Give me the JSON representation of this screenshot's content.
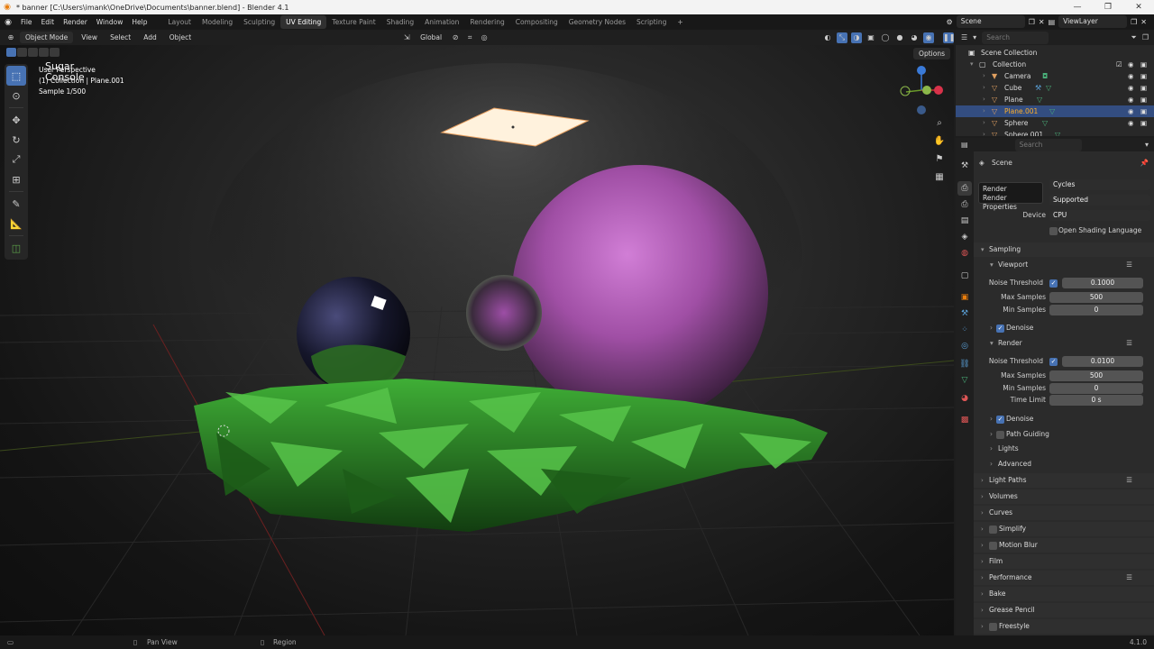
{
  "window": {
    "title": "* banner [C:\\Users\\imank\\OneDrive\\Documents\\banner.blend] - Blender 4.1",
    "buttons": [
      "—",
      "❐",
      "✕"
    ]
  },
  "menu": [
    "File",
    "Edit",
    "Render",
    "Window",
    "Help"
  ],
  "workspaces": [
    "Layout",
    "Modeling",
    "Sculpting",
    "UV Editing",
    "Texture Paint",
    "Shading",
    "Animation",
    "Rendering",
    "Compositing",
    "Geometry Nodes",
    "Scripting"
  ],
  "active_workspace": "UV Editing",
  "topbar_right": {
    "scene": "Scene",
    "view_layer": "ViewLayer"
  },
  "viewport_header": {
    "mode": "Object Mode",
    "menus": [
      "View",
      "Select",
      "Add",
      "Object"
    ],
    "orientation": "Global",
    "options": "Options"
  },
  "viewport_overlay": {
    "line1": "User Perspective",
    "line2": "(1) Collection | Plane.001",
    "line3": "Sample 1/500",
    "watermark_1": "Sugar",
    "watermark_2": "Console"
  },
  "statusbar": {
    "left": "Pan View",
    "middle": "Region",
    "version": "4.1.0"
  },
  "outliner": {
    "search_placeholder": "Search",
    "root": "Scene Collection",
    "collection": "Collection",
    "items": [
      {
        "name": "Camera",
        "icon": "camera-icon"
      },
      {
        "name": "Cube",
        "icon": "mesh-icon"
      },
      {
        "name": "Plane",
        "icon": "mesh-icon"
      },
      {
        "name": "Plane.001",
        "icon": "mesh-icon",
        "selected": true
      },
      {
        "name": "Sphere",
        "icon": "mesh-icon"
      },
      {
        "name": "Sphere.001",
        "icon": "mesh-icon"
      }
    ]
  },
  "properties": {
    "search_placeholder": "Search",
    "context": "Scene",
    "tooltip_title": "Render",
    "tooltip_sub": "Render Properties",
    "render_engine": "Cycles",
    "feature_set": "Supported",
    "device_label": "Device",
    "device": "CPU",
    "osl_label": "Open Shading Language",
    "sampling": "Sampling",
    "viewport": {
      "title": "Viewport",
      "noise_threshold_label": "Noise Threshold",
      "noise_threshold": "0.1000",
      "max_samples_label": "Max Samples",
      "max_samples": "500",
      "min_samples_label": "Min Samples",
      "min_samples": "0",
      "denoise": "Denoise"
    },
    "render": {
      "title": "Render",
      "noise_threshold_label": "Noise Threshold",
      "noise_threshold": "0.0100",
      "max_samples_label": "Max Samples",
      "max_samples": "500",
      "min_samples_label": "Min Samples",
      "min_samples": "0",
      "time_limit_label": "Time Limit",
      "time_limit": "0 s",
      "denoise": "Denoise",
      "path_guiding": "Path Guiding",
      "lights": "Lights",
      "advanced": "Advanced"
    },
    "panels": [
      "Light Paths",
      "Volumes",
      "Curves",
      "Simplify",
      "Motion Blur",
      "Film",
      "Performance",
      "Bake",
      "Grease Pencil",
      "Freestyle"
    ]
  },
  "colors": {
    "accent": "#4772b3",
    "selection": "#334d80",
    "sphere": "#b35fb8",
    "ground": "#2f9e2a",
    "orange": "#e87d0d"
  }
}
